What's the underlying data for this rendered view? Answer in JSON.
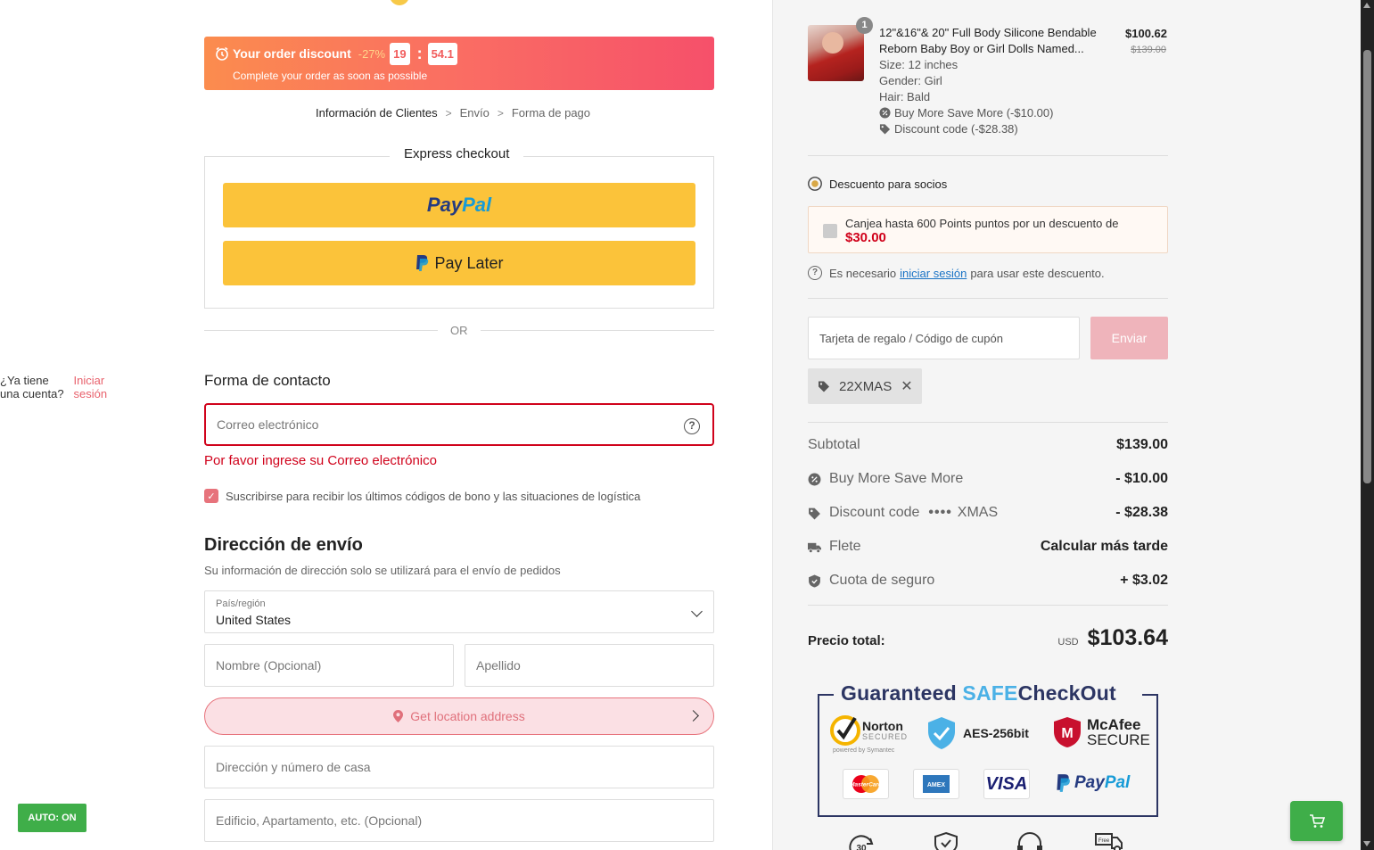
{
  "promo": {
    "title": "Your order discount",
    "percent": "-27%",
    "timer_min": "19",
    "timer_sep": ":",
    "timer_sec": "54.1",
    "subtitle": "Complete your order as soon as possible"
  },
  "breadcrumb": {
    "step1": "Información de Clientes",
    "step2": "Envío",
    "step3": "Forma de pago",
    "separator": ">"
  },
  "express": {
    "title": "Express checkout",
    "paypal_part1": "Pay",
    "paypal_part2": "Pal",
    "pay_later": "Pay Later",
    "or": "OR"
  },
  "contact": {
    "title": "Forma de contacto",
    "have_account": "¿Ya tiene una cuenta?",
    "login": "Iniciar sesión",
    "email_placeholder": "Correo electrónico",
    "email_error": "Por favor ingrese su Correo electrónico",
    "subscribe_label": "Suscribirse para recibir los últimos códigos de bono y las situaciones de logística",
    "subscribe_checked": true
  },
  "shipping": {
    "title": "Dirección de envío",
    "subtitle": "Su información de dirección solo se utilizará para el envío de pedidos",
    "country_label": "País/región",
    "country_value": "United States",
    "first_name_placeholder": "Nombre (Opcional)",
    "last_name_placeholder": "Apellido",
    "location_button": "Get location address",
    "address_placeholder": "Dirección y número de casa",
    "address2_placeholder": "Edificio, Apartamento, etc. (Opcional)"
  },
  "auto_button": "AUTO: ON",
  "product": {
    "quantity": "1",
    "name": "12\"&16\"& 20\" Full Body Silicone Bendable Reborn Baby Boy or Girl Dolls Named...",
    "price": "$100.62",
    "old_price": "$139.00",
    "size": "Size: 12 inches",
    "gender": "Gender: Girl",
    "hair": "Hair: Bald",
    "promo1": "Buy More Save More (-$10.00)",
    "promo2": "Discount code (-$28.38)"
  },
  "members": {
    "title": "Descuento para socios",
    "redeem_text": "Canjea hasta 600 Points puntos por un descuento de",
    "redeem_amount": "$30.00",
    "need_prefix": "Es necesario",
    "need_link": "iniciar sesión",
    "need_suffix": "para usar este descuento."
  },
  "coupon": {
    "placeholder": "Tarjeta de regalo / Código de cupón",
    "submit": "Enviar",
    "applied_code": "22XMAS"
  },
  "summary": {
    "subtotal_label": "Subtotal",
    "subtotal_value": "$139.00",
    "bmsm_label": "Buy More Save More",
    "bmsm_value": "- $10.00",
    "discount_label": "Discount code",
    "discount_dots": "••••",
    "discount_code": "XMAS",
    "discount_value": "- $28.38",
    "shipping_label": "Flete",
    "shipping_value": "Calcular más tarde",
    "insurance_label": "Cuota de seguro",
    "insurance_value": "+ $3.02",
    "total_label": "Precio total:",
    "currency": "USD",
    "total_value": "$103.64"
  },
  "trust": {
    "title_part1": "Guaranteed",
    "title_part2": "SAFE",
    "title_part3": "CheckOut",
    "norton": "Norton",
    "norton_sub": "SECURED",
    "norton_powered": "powered by Symantec",
    "aes": "AES-256bit",
    "mcafee": "McAfee",
    "mcafee_sub": "SECURE",
    "visa": "VISA",
    "paypal_part1": "Pay",
    "paypal_part2": "Pal",
    "amex": "AMEX",
    "mastercard": "MasterCard"
  },
  "colors": {
    "accent_pink": "#e8626d",
    "error_red": "#d0021b",
    "paypal_yellow": "#fbc33a",
    "green": "#3fae49"
  }
}
